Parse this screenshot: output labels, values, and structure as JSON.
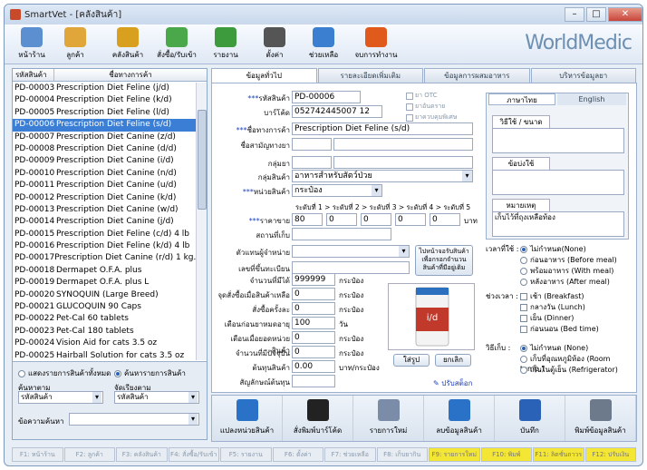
{
  "window": {
    "title": "SmartVet - [คลังสินค้า]"
  },
  "toolbar": {
    "items": [
      {
        "label": "หน้าร้าน",
        "icon": "monitor-icon",
        "color": "#5b8fd0"
      },
      {
        "label": "ลูกค้า",
        "icon": "users-icon",
        "color": "#e0a63a"
      },
      {
        "label": "คลังสินค้า",
        "icon": "warehouse-icon",
        "color": "#d9a020"
      },
      {
        "label": "สั่งซื้อ/รับเข้า",
        "icon": "order-icon",
        "color": "#4aa84a"
      },
      {
        "label": "รายงาน",
        "icon": "chart-icon",
        "color": "#3d9a3d"
      },
      {
        "label": "ตั้งค่า",
        "icon": "settings-icon",
        "color": "#555"
      },
      {
        "label": "ช่วยเหลือ",
        "icon": "help-icon",
        "color": "#3b7fd0"
      },
      {
        "label": "จบการทำงาน",
        "icon": "power-icon",
        "color": "#e05a1c"
      }
    ],
    "brand": "WorldMedic"
  },
  "list": {
    "col1": "รหัสสินค้า",
    "col2": "ชื่อทางการค้า",
    "rows": [
      [
        "PD-00003",
        "Prescription Diet Feline (j/d)"
      ],
      [
        "PD-00004",
        "Prescription Diet Feline (k/d)"
      ],
      [
        "PD-00005",
        "Prescription Diet Feline (l/d)"
      ],
      [
        "PD-00006",
        "Prescription Diet Feline (s/d)"
      ],
      [
        "PD-00007",
        "Prescription Diet Canine (z/d)"
      ],
      [
        "PD-00008",
        "Prescription Diet Canine (d/d)"
      ],
      [
        "PD-00009",
        "Prescription Diet Canine (i/d)"
      ],
      [
        "PD-00010",
        "Prescription Diet Canine (n/d)"
      ],
      [
        "PD-00011",
        "Prescription Diet Canine (u/d)"
      ],
      [
        "PD-00012",
        "Prescription Diet Canine (k/d)"
      ],
      [
        "PD-00013",
        "Prescription Diet Canine (w/d)"
      ],
      [
        "PD-00014",
        "Prescription Diet Canine (j/d)"
      ],
      [
        "PD-00015",
        "Prescription Diet Feline (c/d) 4 lb"
      ],
      [
        "PD-00016",
        "Prescription Diet Feline (k/d) 4 lb"
      ],
      [
        "PD-00017",
        "Prescription Diet Canine (r/d) 1 kg."
      ],
      [
        "PD-00018",
        "Dermapet O.F.A. plus"
      ],
      [
        "PD-00019",
        "Dermapet O.F.A. plus L"
      ],
      [
        "PD-00020",
        "SYNOQUIN (Large Breed)"
      ],
      [
        "PD-00021",
        "GLUCOQUIN 90 Caps"
      ],
      [
        "PD-00022",
        "Pet-Cal 60 tablets"
      ],
      [
        "PD-00023",
        "Pet-Cal 180 tablets"
      ],
      [
        "PD-00024",
        "Vision Aid for cats  3.5 oz"
      ],
      [
        "PD-00025",
        "Hairball Solution for cats 3.5 oz"
      ]
    ],
    "selected_index": 3
  },
  "filters": {
    "show_all": "แสดงรายการสินค้าทั้งหมด",
    "search_list": "ค้นหารายการสินค้า",
    "search_by_label": "ค้นหาตาม",
    "search_by_value": "รหัสสินค้า",
    "sort_by_label": "จัดเรียงตาม",
    "sort_by_value": "รหัสสินค้า",
    "keyword_label": "ข้อความค้นหา"
  },
  "tabs": [
    "ข้อมูลทั่วไป",
    "รายละเอียดเพิ่มเติม",
    "ข้อมูลการผสมอาหาร",
    "บริหารข้อมูลยา"
  ],
  "form": {
    "code_label": "รหัสสินค้า",
    "code": "PD-00006",
    "barcode_label": "บาร์โค้ด",
    "barcode": "052742445007 12",
    "trade_label": "ชื่อทางการค้า",
    "trade": "Prescription Diet Feline (s/d)",
    "generic_label": "ชื่อสามัญทางยา",
    "group_label": "กลุ่มยา",
    "product_group_label": "กลุ่มสินค้า",
    "product_group": "อาหารสำหรับสัตว์ป่วย",
    "unit_label": "หน่วยสินค้า",
    "unit": "กระป๋อง",
    "otc": "ยา OTC",
    "dangerous": "ยาอันตราย",
    "controlled": "ยาควบคุมพิเศษ",
    "level_header": "ระดับที่ 1 > ระดับที่ 2 > ระดับที่ 3 > ระดับที่ 4 > ระดับที่ 5",
    "price_label": "ราคาขาย",
    "price": [
      "80",
      "0",
      "0",
      "0",
      "0"
    ],
    "baht": "บาท",
    "storage_label": "สถานที่เก็บ",
    "distributor_label": "ตัวแทนผู้จำหน่าย",
    "reg_label": "เลขที่ขึ้นทะเบียน",
    "qty_label": "จำนวนที่มีได้",
    "qty": "999999",
    "reorder_label": "จุดสั่งซื้อเมื่อสินค้าเหลือ",
    "reorder": "0",
    "perorder_label": "สั่งซื้อครั้งละ",
    "perorder": "0",
    "expiry_label": "เตือนก่อนยาหมดอายุ",
    "expiry": "100",
    "day": "วัน",
    "stockwarn_label": "เตือนเมื่อยอดหน่วยสินค้า",
    "stockwarn": "0",
    "current_label": "จำนวนที่มีปัจจุบัน",
    "current": "0",
    "cost_label": "ต้นทุนสินค้า",
    "cost": "0.00",
    "cost_unit": "บาท/กระป๋อง",
    "symbol_label": "สัญลักษณ์ต้นทุน",
    "can": "กระป๋อง",
    "supplier_btn": "ไปหน้าจอรับสินค้า เพื่อกรอกจำนวน สินค้าที่มีอยู่เดิม",
    "add_photo": "ใส่รูป",
    "remove_photo": "ยกเลิก",
    "adjust_stock": "ปรับสต็อก"
  },
  "rpanel": {
    "tab_th": "ภาษาไทย",
    "tab_en": "English",
    "usage": "วิธีใช้ / ขนาด",
    "indication": "ข้อบ่งใช้",
    "note_label": "หมายเหตุ",
    "note": "เก็บไว้ที่ถุงเหลือท้อง",
    "time_label": "เวลาที่ใช้ :",
    "times": [
      "ไม่กำหนด(None)",
      "ก่อนอาหาร (Before meal)",
      "พร้อมอาหาร (With meal)",
      "หลังอาหาร (After meal)"
    ],
    "period_label": "ช่วงเวลา :",
    "periods": [
      "เช้า (Breakfast)",
      "กลางวัน (Lunch)",
      "เย็น (Dinner)",
      "ก่อนนอน (Bed time)"
    ],
    "store_label": "วิธีเก็บ :",
    "stores": [
      "ไม่กำหนด (None)",
      "เก็บที่อุณหภูมิห้อง (Room temp.)",
      "เก็บในตู้เย็น (Refrigerator)"
    ]
  },
  "bottom": [
    {
      "label": "แปลงหน่วยสินค้า",
      "icon": "convert-icon",
      "color": "#2a72c8"
    },
    {
      "label": "สั่งพิมพ์บาร์โค้ด",
      "icon": "barcode-icon",
      "color": "#222"
    },
    {
      "label": "รายการใหม่",
      "icon": "new-doc-icon",
      "color": "#7a8ca8"
    },
    {
      "label": "ลบข้อมูลสินค้า",
      "icon": "delete-icon",
      "color": "#2a72c8"
    },
    {
      "label": "บันทึก",
      "icon": "save-icon",
      "color": "#2a62b8"
    },
    {
      "label": "พิมพ์ข้อมูลสินค้า",
      "icon": "print-icon",
      "color": "#6d7a8c"
    }
  ],
  "fkeys": [
    "F1: หน้าร้าน",
    "F2: ลูกค้า",
    "F3: คลังสินค้า",
    "F4: สั่งซื้อ/รับเข้า",
    "F5: รายงาน",
    "F6: ตั้งค่า",
    "F7: ช่วยเหลือ",
    "F8: เก็บยากิน",
    "F9: รายการใหม่",
    "F10: พิมพ์รายการ",
    "F11: ลิตชั่นถาวร",
    "F12: ปรับเงิน"
  ]
}
